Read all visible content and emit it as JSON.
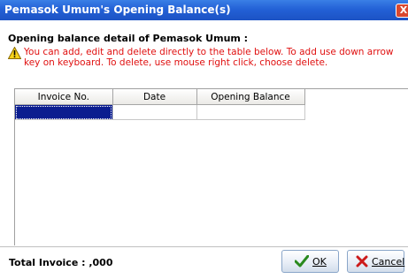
{
  "window": {
    "title": "Pemasok Umum's Opening Balance(s)",
    "close_glyph": "X"
  },
  "heading": "Opening balance detail of Pemasok Umum :",
  "message": "You can add, edit and delete directly to the table below. To add use down arrow key on keyboard. To delete, use mouse right click, choose delete.",
  "table": {
    "columns": [
      "Invoice No.",
      "Date",
      "Opening Balance"
    ],
    "rows": [
      [
        "",
        "",
        ""
      ]
    ]
  },
  "footer": {
    "total_label": "Total Invoice : ,000",
    "ok_label": "OK",
    "cancel_label": "Cancel"
  },
  "icons": {
    "warning": "warning-icon",
    "ok": "checkmark-icon",
    "cancel": "x-icon",
    "close": "close-icon"
  },
  "colors": {
    "title_bar": "#2361d6",
    "warning_text": "#e01010",
    "selected_cell": "#0b1d8f",
    "cancel_x": "#cc1a1a",
    "ok_check": "#2a8a1e"
  }
}
